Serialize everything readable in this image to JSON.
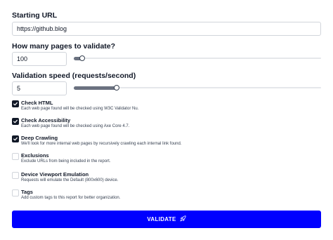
{
  "form": {
    "starting_url": {
      "label": "Starting URL",
      "value": "https://github.blog"
    },
    "pages": {
      "label": "How many pages to validate?",
      "value": "100",
      "slider_level": 0.02
    },
    "speed": {
      "label": "Validation speed (requests/second)",
      "value": "5",
      "slider_level": 0.18
    }
  },
  "options": [
    {
      "title": "Check HTML",
      "desc": "Each web page found will be checked using W3C Validator Nu.",
      "checked": true
    },
    {
      "title": "Check Accessibility",
      "desc": "Each web page found will be checked using Axe Core 4.7.",
      "checked": true
    },
    {
      "title": "Deep Crawling",
      "desc": "We'll look for more internal web pages by recursively crawling each internal link found.",
      "checked": true
    },
    {
      "title": "Exclusions",
      "desc": "Exclude URLs from being included in the report.",
      "checked": false
    },
    {
      "title": "Device Viewport Emulation",
      "desc": "Requests will emulate the Default (800x600) device.",
      "checked": false
    },
    {
      "title": "Tags",
      "desc": "Add custom tags to this report for better organization.",
      "checked": false
    }
  ],
  "submit": {
    "label": "VALIDATE",
    "icon": "rocket-icon",
    "color": "#0000ff"
  }
}
